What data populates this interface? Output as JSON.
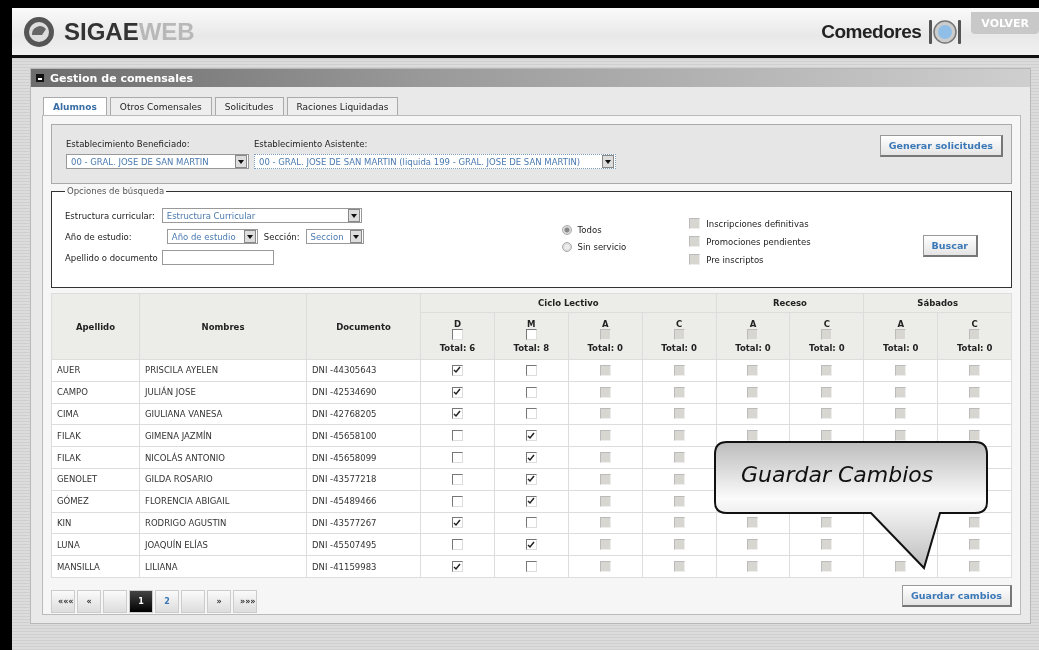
{
  "header": {
    "logo_main": "SIGAE",
    "logo_accent": "WEB",
    "module": "Comedores",
    "back_button": "VOLVER"
  },
  "panel_title": "Gestion de comensales",
  "tabs": [
    {
      "label": "Alumnos",
      "selected": true
    },
    {
      "label": "Otros Comensales",
      "selected": false
    },
    {
      "label": "Solicitudes",
      "selected": false
    },
    {
      "label": "Raciones Liquidadas",
      "selected": false
    }
  ],
  "establishment": {
    "beneficiado_label": "Establecimiento Beneficiado:",
    "beneficiado_value": "00 - GRAL. JOSE DE SAN MARTIN",
    "asistente_label": "Establecimiento Asistente:",
    "asistente_value": "00 - GRAL. JOSE DE SAN MARTIN (liquida 199 - GRAL. JOSE DE SAN MARTIN)",
    "generate_button": "Generar solicitudes"
  },
  "search": {
    "legend": "Opciones de búsqueda",
    "curricular_label": "Estructura curricular:",
    "curricular_value": "Estructura Curricular",
    "year_label": "Año de estudio:",
    "year_value": "Año de estudio",
    "section_label": "Sección:",
    "section_value": "Seccion",
    "name_label": "Apellido o documento",
    "radios": [
      {
        "label": "Todos",
        "selected": true
      },
      {
        "label": "Sin servicio",
        "selected": false
      }
    ],
    "filters": [
      {
        "label": "Inscripciones definitivas",
        "checked": false
      },
      {
        "label": "Promociones pendientes",
        "checked": false
      },
      {
        "label": "Pre inscriptos",
        "checked": false
      }
    ],
    "button": "Buscar"
  },
  "table": {
    "fixed_columns": [
      "Apellido",
      "Nombres",
      "Documento"
    ],
    "groups": [
      {
        "label": "Ciclo Lectivo",
        "columns": [
          {
            "letter": "D",
            "checked": false,
            "disabled": false,
            "total": "Total: 6"
          },
          {
            "letter": "M",
            "checked": false,
            "disabled": false,
            "total": "Total: 8"
          },
          {
            "letter": "A",
            "checked": false,
            "disabled": true,
            "total": "Total: 0"
          },
          {
            "letter": "C",
            "checked": false,
            "disabled": true,
            "total": "Total: 0"
          }
        ]
      },
      {
        "label": "Receso",
        "columns": [
          {
            "letter": "A",
            "checked": false,
            "disabled": true,
            "total": "Total: 0"
          },
          {
            "letter": "C",
            "checked": false,
            "disabled": true,
            "total": "Total: 0"
          }
        ]
      },
      {
        "label": "Sábados",
        "columns": [
          {
            "letter": "A",
            "checked": false,
            "disabled": true,
            "total": "Total: 0"
          },
          {
            "letter": "C",
            "checked": false,
            "disabled": true,
            "total": "Total: 0"
          }
        ]
      }
    ],
    "rows": [
      {
        "apellido": "AUER",
        "nombres": "PRISCILA AYELEN",
        "documento": "DNI -44305643",
        "checks": [
          {
            "checked": true,
            "disabled": false
          },
          {
            "checked": false,
            "disabled": false
          },
          {
            "checked": false,
            "disabled": true
          },
          {
            "checked": false,
            "disabled": true
          },
          {
            "checked": false,
            "disabled": true
          },
          {
            "checked": false,
            "disabled": true
          },
          {
            "checked": false,
            "disabled": true
          },
          {
            "checked": false,
            "disabled": true
          }
        ]
      },
      {
        "apellido": "CAMPO",
        "nombres": "JULIÁN JOSE",
        "documento": "DNI -42534690",
        "checks": [
          {
            "checked": true,
            "disabled": false
          },
          {
            "checked": false,
            "disabled": false
          },
          {
            "checked": false,
            "disabled": true
          },
          {
            "checked": false,
            "disabled": true
          },
          {
            "checked": false,
            "disabled": true
          },
          {
            "checked": false,
            "disabled": true
          },
          {
            "checked": false,
            "disabled": true
          },
          {
            "checked": false,
            "disabled": true
          }
        ]
      },
      {
        "apellido": "CIMA",
        "nombres": "GIULIANA VANESA",
        "documento": "DNI -42768205",
        "checks": [
          {
            "checked": true,
            "disabled": false
          },
          {
            "checked": false,
            "disabled": false
          },
          {
            "checked": false,
            "disabled": true
          },
          {
            "checked": false,
            "disabled": true
          },
          {
            "checked": false,
            "disabled": true
          },
          {
            "checked": false,
            "disabled": true
          },
          {
            "checked": false,
            "disabled": true
          },
          {
            "checked": false,
            "disabled": true
          }
        ]
      },
      {
        "apellido": "FILAK",
        "nombres": "GIMENA JAZMÍN",
        "documento": "DNI -45658100",
        "checks": [
          {
            "checked": false,
            "disabled": false
          },
          {
            "checked": true,
            "disabled": false
          },
          {
            "checked": false,
            "disabled": true
          },
          {
            "checked": false,
            "disabled": true
          },
          {
            "checked": false,
            "disabled": true
          },
          {
            "checked": false,
            "disabled": true
          },
          {
            "checked": false,
            "disabled": true
          },
          {
            "checked": false,
            "disabled": true
          }
        ]
      },
      {
        "apellido": "FILAK",
        "nombres": "NICOLÁS ANTONIO",
        "documento": "DNI -45658099",
        "checks": [
          {
            "checked": false,
            "disabled": false
          },
          {
            "checked": true,
            "disabled": false
          },
          {
            "checked": false,
            "disabled": true
          },
          {
            "checked": false,
            "disabled": true
          },
          {
            "kind": "covered"
          },
          {
            "kind": "covered"
          },
          {
            "kind": "covered"
          },
          {
            "kind": "covered"
          }
        ]
      },
      {
        "apellido": "GENOLET",
        "nombres": "GILDA ROSARIO",
        "documento": "DNI -43577218",
        "checks": [
          {
            "checked": false,
            "disabled": false
          },
          {
            "checked": true,
            "disabled": false
          },
          {
            "checked": false,
            "disabled": true
          },
          {
            "checked": false,
            "disabled": true
          },
          {
            "kind": "covered"
          },
          {
            "kind": "covered"
          },
          {
            "kind": "covered"
          },
          {
            "kind": "covered"
          }
        ]
      },
      {
        "apellido": "GÓMEZ",
        "nombres": "FLORENCIA ABIGAIL",
        "documento": "DNI -45489466",
        "checks": [
          {
            "checked": false,
            "disabled": false
          },
          {
            "checked": true,
            "disabled": false
          },
          {
            "checked": false,
            "disabled": true
          },
          {
            "checked": false,
            "disabled": true
          },
          {
            "kind": "covered"
          },
          {
            "kind": "covered"
          },
          {
            "kind": "covered"
          },
          {
            "kind": "covered"
          }
        ]
      },
      {
        "apellido": "KIN",
        "nombres": "RODRIGO AGUSTIN",
        "documento": "DNI -43577267",
        "checks": [
          {
            "checked": true,
            "disabled": false
          },
          {
            "checked": false,
            "disabled": false
          },
          {
            "checked": false,
            "disabled": true
          },
          {
            "checked": false,
            "disabled": true
          },
          {
            "checked": false,
            "disabled": true
          },
          {
            "checked": false,
            "disabled": true
          },
          {
            "kind": "covered"
          },
          {
            "checked": false,
            "disabled": true
          }
        ]
      },
      {
        "apellido": "LUNA",
        "nombres": "JOAQUÍN ELÍAS",
        "documento": "DNI -45507495",
        "checks": [
          {
            "checked": false,
            "disabled": false
          },
          {
            "checked": true,
            "disabled": false
          },
          {
            "checked": false,
            "disabled": true
          },
          {
            "checked": false,
            "disabled": true
          },
          {
            "checked": false,
            "disabled": true
          },
          {
            "checked": false,
            "disabled": true
          },
          {
            "kind": "covered"
          },
          {
            "checked": false,
            "disabled": true
          }
        ]
      },
      {
        "apellido": "MANSILLA",
        "nombres": "LILIANA",
        "documento": "DNI -41159983",
        "checks": [
          {
            "checked": true,
            "disabled": false
          },
          {
            "checked": false,
            "disabled": false
          },
          {
            "checked": false,
            "disabled": true
          },
          {
            "checked": false,
            "disabled": true
          },
          {
            "checked": false,
            "disabled": true
          },
          {
            "checked": false,
            "disabled": true
          },
          {
            "checked": false,
            "disabled": true
          },
          {
            "checked": false,
            "disabled": true
          }
        ]
      }
    ]
  },
  "pagination": [
    {
      "kind": "nav",
      "label": "«««"
    },
    {
      "kind": "nav",
      "label": "«"
    },
    {
      "kind": "blank"
    },
    {
      "kind": "page",
      "label": "1",
      "selected": true
    },
    {
      "kind": "page",
      "label": "2",
      "selected": false
    },
    {
      "kind": "blank"
    },
    {
      "kind": "nav",
      "label": "»"
    },
    {
      "kind": "nav",
      "label": "»»»"
    }
  ],
  "save_button": "Guardar cambios",
  "callout": "Guardar Cambios"
}
